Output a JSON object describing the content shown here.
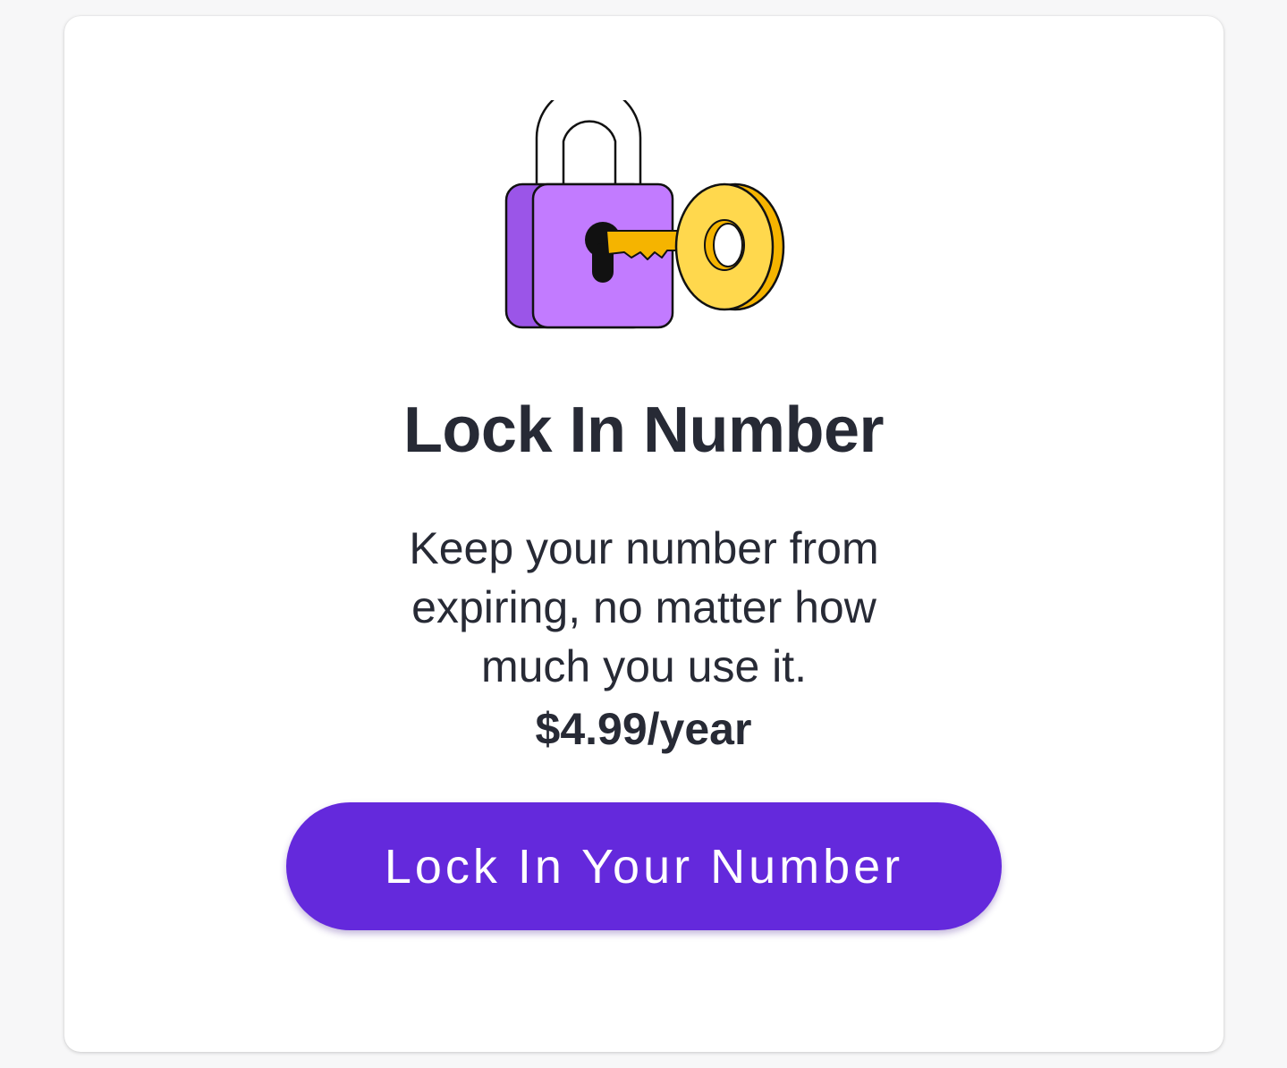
{
  "illustration": {
    "icon": "lock-and-key-icon",
    "colors": {
      "lock_body": "#c27bff",
      "lock_side": "#9b55e8",
      "key": "#ffd84d",
      "key_dark": "#f5b400",
      "outline": "#111111"
    }
  },
  "card": {
    "title": "Lock In Number",
    "description": "Keep your number from expiring, no matter how much you use it.",
    "price": "$4.99/year",
    "cta_label": "Lock In Your Number"
  },
  "theme": {
    "accent": "#6429dc",
    "text": "#272a35",
    "background": "#f7f7f8"
  }
}
